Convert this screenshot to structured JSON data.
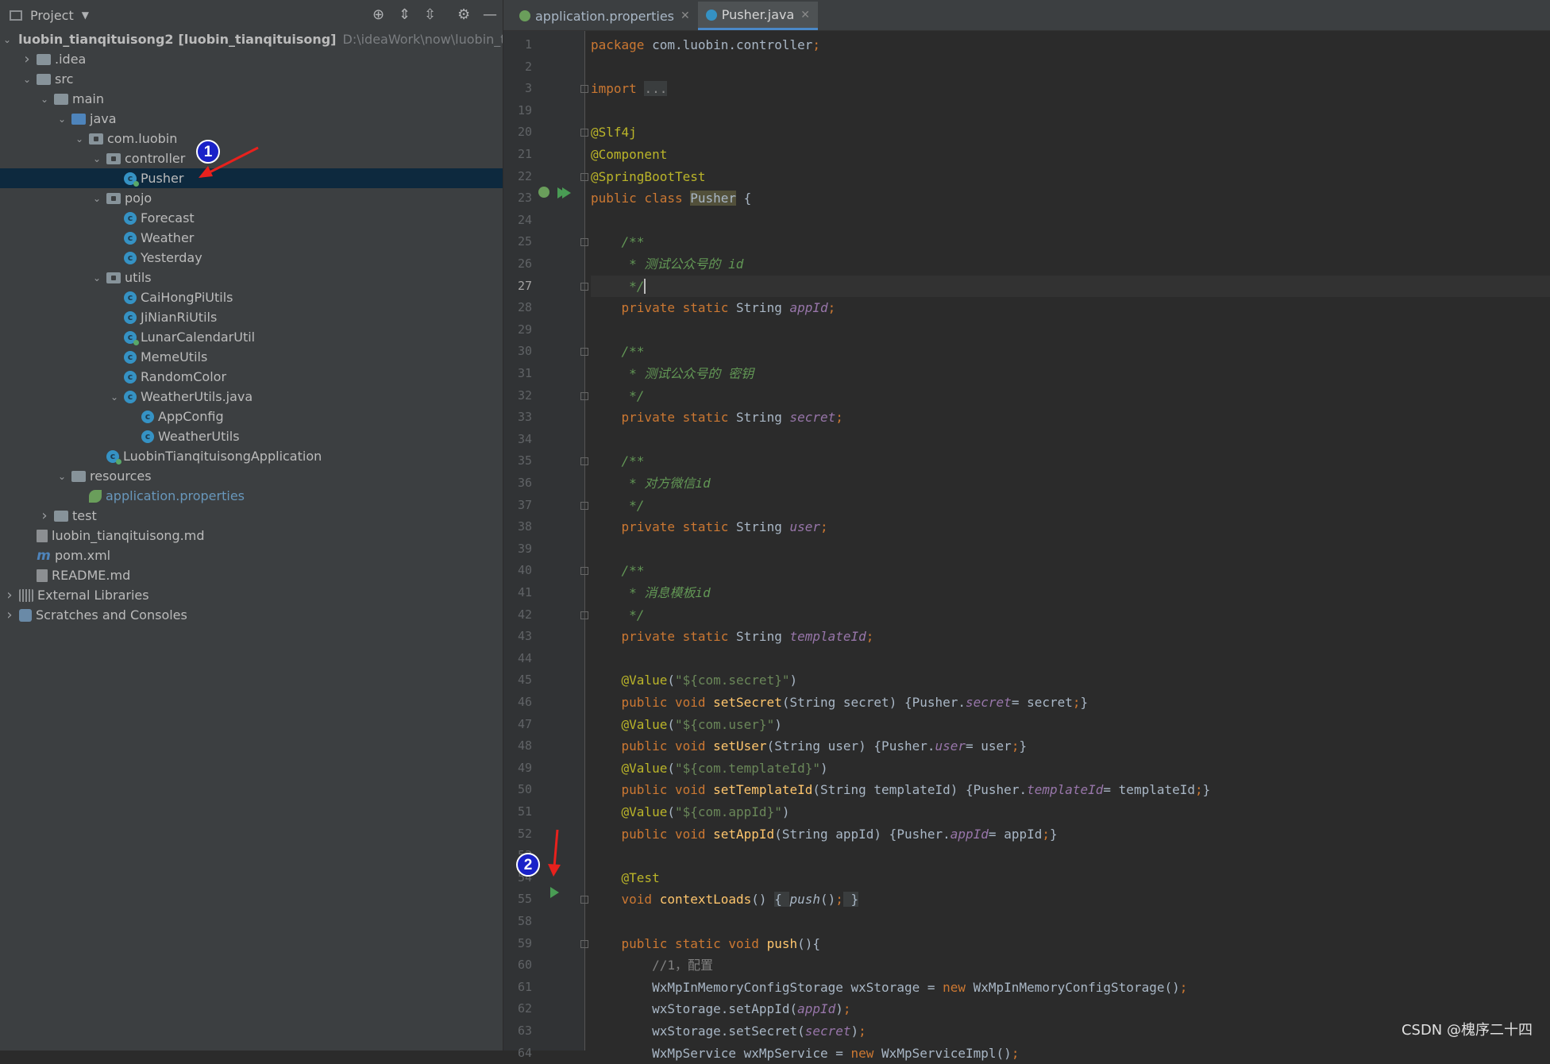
{
  "panel": {
    "title": "Project",
    "tree": [
      {
        "label": "luobin_tianqituisong2",
        "extra": "[luobin_tianqituisong]",
        "path": "D:\\ideaWork\\now\\luobin_tianqitui",
        "icon": "module-folder-icon",
        "depth": 0,
        "expanded": true
      },
      {
        "label": ".idea",
        "icon": "folder-icon",
        "depth": 1,
        "expanded": false
      },
      {
        "label": "src",
        "icon": "folder-icon",
        "depth": 1,
        "expanded": true
      },
      {
        "label": "main",
        "icon": "folder-icon",
        "depth": 2,
        "expanded": true
      },
      {
        "label": "java",
        "icon": "source-folder-icon",
        "depth": 3,
        "expanded": true
      },
      {
        "label": "com.luobin",
        "icon": "package-icon",
        "depth": 4,
        "expanded": true
      },
      {
        "label": "controller",
        "icon": "package-icon",
        "depth": 5,
        "expanded": true
      },
      {
        "label": "Pusher",
        "icon": "spring-class-icon",
        "depth": 6,
        "selected": true
      },
      {
        "label": "pojo",
        "icon": "package-icon",
        "depth": 5,
        "expanded": true
      },
      {
        "label": "Forecast",
        "icon": "class-icon",
        "depth": 6
      },
      {
        "label": "Weather",
        "icon": "class-icon",
        "depth": 6
      },
      {
        "label": "Yesterday",
        "icon": "class-icon",
        "depth": 6
      },
      {
        "label": "utils",
        "icon": "package-icon",
        "depth": 5,
        "expanded": true
      },
      {
        "label": "CaiHongPiUtils",
        "icon": "class-icon",
        "depth": 6
      },
      {
        "label": "JiNianRiUtils",
        "icon": "class-icon",
        "depth": 6
      },
      {
        "label": "LunarCalendarUtil",
        "icon": "spring-class-icon",
        "depth": 6
      },
      {
        "label": "MemeUtils",
        "icon": "class-icon",
        "depth": 6
      },
      {
        "label": "RandomColor",
        "icon": "class-icon",
        "depth": 6
      },
      {
        "label": "WeatherUtils.java",
        "icon": "class-icon",
        "depth": 6,
        "expanded": true
      },
      {
        "label": "AppConfig",
        "icon": "class-icon",
        "depth": 7
      },
      {
        "label": "WeatherUtils",
        "icon": "class-icon",
        "depth": 7
      },
      {
        "label": "LuobinTianqituisongApplication",
        "icon": "spring-boot-class-icon",
        "depth": 5
      },
      {
        "label": "resources",
        "icon": "resources-folder-icon",
        "depth": 3,
        "expanded": true
      },
      {
        "label": "application.properties",
        "icon": "spring-properties-icon",
        "depth": 4,
        "link": true
      },
      {
        "label": "test",
        "icon": "folder-icon",
        "depth": 2,
        "expanded": false
      },
      {
        "label": "luobin_tianqituisong.md",
        "icon": "markdown-file-icon",
        "depth": 1
      },
      {
        "label": "pom.xml",
        "icon": "maven-file-icon",
        "depth": 1
      },
      {
        "label": "README.md",
        "icon": "markdown-file-icon",
        "depth": 1
      },
      {
        "label": "External Libraries",
        "icon": "libraries-icon",
        "depth": 0,
        "expanded": false
      },
      {
        "label": "Scratches and Consoles",
        "icon": "scratches-icon",
        "depth": 0,
        "expanded": false
      }
    ]
  },
  "tabs": [
    {
      "label": "application.properties",
      "active": false
    },
    {
      "label": "Pusher.java",
      "active": true
    }
  ],
  "annotations": {
    "badge1": "1",
    "badge2": "2"
  },
  "watermark": "CSDN @槐序二十四",
  "code": [
    {
      "n": "1",
      "html": "<span class='kw'>package </span>com.luobin.controller<span class='kw'>;</span>"
    },
    {
      "n": "2",
      "html": ""
    },
    {
      "n": "3",
      "html": "<span class='kw'>import </span><span style='background:#3a3d3e;color:#888'>...</span>"
    },
    {
      "n": "19",
      "html": ""
    },
    {
      "n": "20",
      "html": "<span class='ann'>@Slf4j</span>"
    },
    {
      "n": "21",
      "html": "<span class='ann'>@Component</span>"
    },
    {
      "n": "22",
      "html": "<span class='ann'>@SpringBootTest</span>"
    },
    {
      "n": "23",
      "html": "<span class='kw'>public class </span><span class='hl'>Pusher</span> {"
    },
    {
      "n": "24",
      "html": ""
    },
    {
      "n": "25",
      "html": "    <span class='cmt'>/**</span>"
    },
    {
      "n": "26",
      "html": "<span class='cmt'>     * 测试公众号的 id</span>"
    },
    {
      "n": "27",
      "html": "<span class='cmt'>     */</span><span class='caret'></span>",
      "current": true
    },
    {
      "n": "28",
      "html": "    <span class='kw'>private static </span>String <span class='fld'>appId</span><span class='kw'>;</span>"
    },
    {
      "n": "29",
      "html": ""
    },
    {
      "n": "30",
      "html": "    <span class='cmt'>/**</span>"
    },
    {
      "n": "31",
      "html": "<span class='cmt'>     * 测试公众号的 密钥</span>"
    },
    {
      "n": "32",
      "html": "<span class='cmt'>     */</span>"
    },
    {
      "n": "33",
      "html": "    <span class='kw'>private static </span>String <span class='fld'>secret</span><span class='kw'>;</span>"
    },
    {
      "n": "34",
      "html": ""
    },
    {
      "n": "35",
      "html": "    <span class='cmt'>/**</span>"
    },
    {
      "n": "36",
      "html": "<span class='cmt'>     * 对方微信id</span>"
    },
    {
      "n": "37",
      "html": "<span class='cmt'>     */</span>"
    },
    {
      "n": "38",
      "html": "    <span class='kw'>private static </span>String <span class='fld'>user</span><span class='kw'>;</span>"
    },
    {
      "n": "39",
      "html": ""
    },
    {
      "n": "40",
      "html": "    <span class='cmt'>/**</span>"
    },
    {
      "n": "41",
      "html": "<span class='cmt'>     * 消息模板id</span>"
    },
    {
      "n": "42",
      "html": "<span class='cmt'>     */</span>"
    },
    {
      "n": "43",
      "html": "    <span class='kw'>private static </span>String <span class='fld'>templateId</span><span class='kw'>;</span>"
    },
    {
      "n": "44",
      "html": ""
    },
    {
      "n": "45",
      "html": "    <span class='ann'>@Value</span>(<span class='str'>\"${com.secret}\"</span>)"
    },
    {
      "n": "46",
      "html": "    <span class='kw'>public void </span><span class='mth'>setSecret</span>(String secret) {Pusher.<span class='fld'>secret</span>= secret<span class='kw'>;</span>}"
    },
    {
      "n": "47",
      "html": "    <span class='ann'>@Value</span>(<span class='str'>\"${com.user}\"</span>)"
    },
    {
      "n": "48",
      "html": "    <span class='kw'>public void </span><span class='mth'>setUser</span>(String user) {Pusher.<span class='fld'>user</span>= user<span class='kw'>;</span>}"
    },
    {
      "n": "49",
      "html": "    <span class='ann'>@Value</span>(<span class='str'>\"${com.templateId}\"</span>)"
    },
    {
      "n": "50",
      "html": "    <span class='kw'>public void </span><span class='mth'>setTemplateId</span>(String templateId) {Pusher.<span class='fld'>templateId</span>= templateId<span class='kw'>;</span>}"
    },
    {
      "n": "51",
      "html": "    <span class='ann'>@Value</span>(<span class='str'>\"${com.appId}\"</span>)"
    },
    {
      "n": "52",
      "html": "    <span class='kw'>public void </span><span class='mth'>setAppId</span>(String appId) {Pusher.<span class='fld'>appId</span>= appId<span class='kw'>;</span>}"
    },
    {
      "n": "53",
      "html": ""
    },
    {
      "n": "54",
      "html": "    <span class='ann'>@Test</span>"
    },
    {
      "n": "55",
      "html": "    <span class='kw'>void </span><span class='mth'>contextLoads</span>() <span style='background:#3a3d3e'>{ </span><span style='font-style:italic'>push</span>()<span class='kw'>;</span><span style='background:#3a3d3e'> }</span>"
    },
    {
      "n": "58",
      "html": ""
    },
    {
      "n": "59",
      "html": "    <span class='kw'>public static void </span><span class='mth'>push</span>(){"
    },
    {
      "n": "60",
      "html": "        <span class='lcmt'>//1，配置</span>"
    },
    {
      "n": "61",
      "html": "        WxMpInMemoryConfigStorage wxStorage = <span class='kw'>new </span>WxMpInMemoryConfigStorage()<span class='kw'>;</span>"
    },
    {
      "n": "62",
      "html": "        wxStorage.setAppId(<span class='fld'>appId</span>)<span class='kw'>;</span>"
    },
    {
      "n": "63",
      "html": "        wxStorage.setSecret(<span class='fld'>secret</span>)<span class='kw'>;</span>"
    },
    {
      "n": "64",
      "html": "        WxMpService wxMpService = <span class='kw'>new </span>WxMpServiceImpl()<span class='kw'>;</span>"
    }
  ]
}
